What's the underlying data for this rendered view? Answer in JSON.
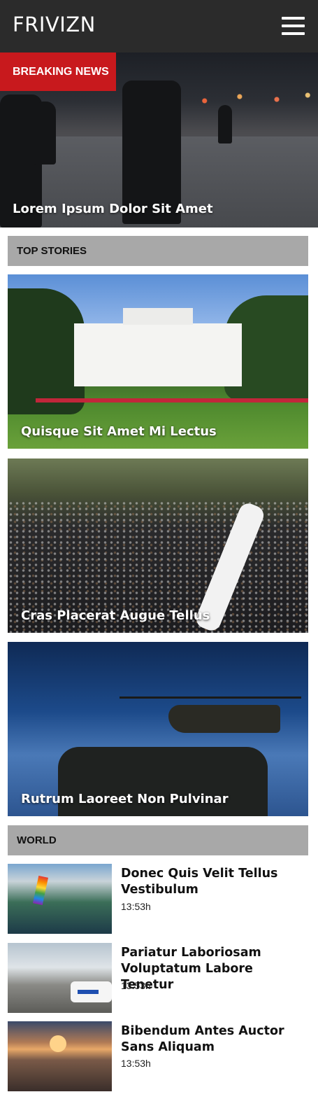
{
  "header": {
    "logo": "FRIVIZN",
    "menu_icon": "hamburger-menu-icon"
  },
  "hero": {
    "badge": "BREAKING NEWS",
    "title": "Lorem Ipsum Dolor Sit Amet"
  },
  "top_stories": {
    "heading": "TOP STORIES",
    "items": [
      {
        "title": "Quisque Sit Amet Mi Lectus"
      },
      {
        "title": "Cras Placerat Augue Tellus"
      },
      {
        "title": "Rutrum Laoreet Non Pulvinar"
      }
    ]
  },
  "world": {
    "heading": "WORLD",
    "items": [
      {
        "title": "Donec Quis Velit Tellus Vestibulum",
        "time": "13:53h"
      },
      {
        "title": "Pariatur Laboriosam Voluptatum Labore Tenetur",
        "time": "13:53h"
      },
      {
        "title": "Bibendum Antes Auctor Sans Aliquam",
        "time": "13:53h"
      }
    ]
  },
  "colors": {
    "header_bg": "#2b2b2b",
    "breaking_red": "#c8191d",
    "section_bar": "#a8a8a8"
  }
}
